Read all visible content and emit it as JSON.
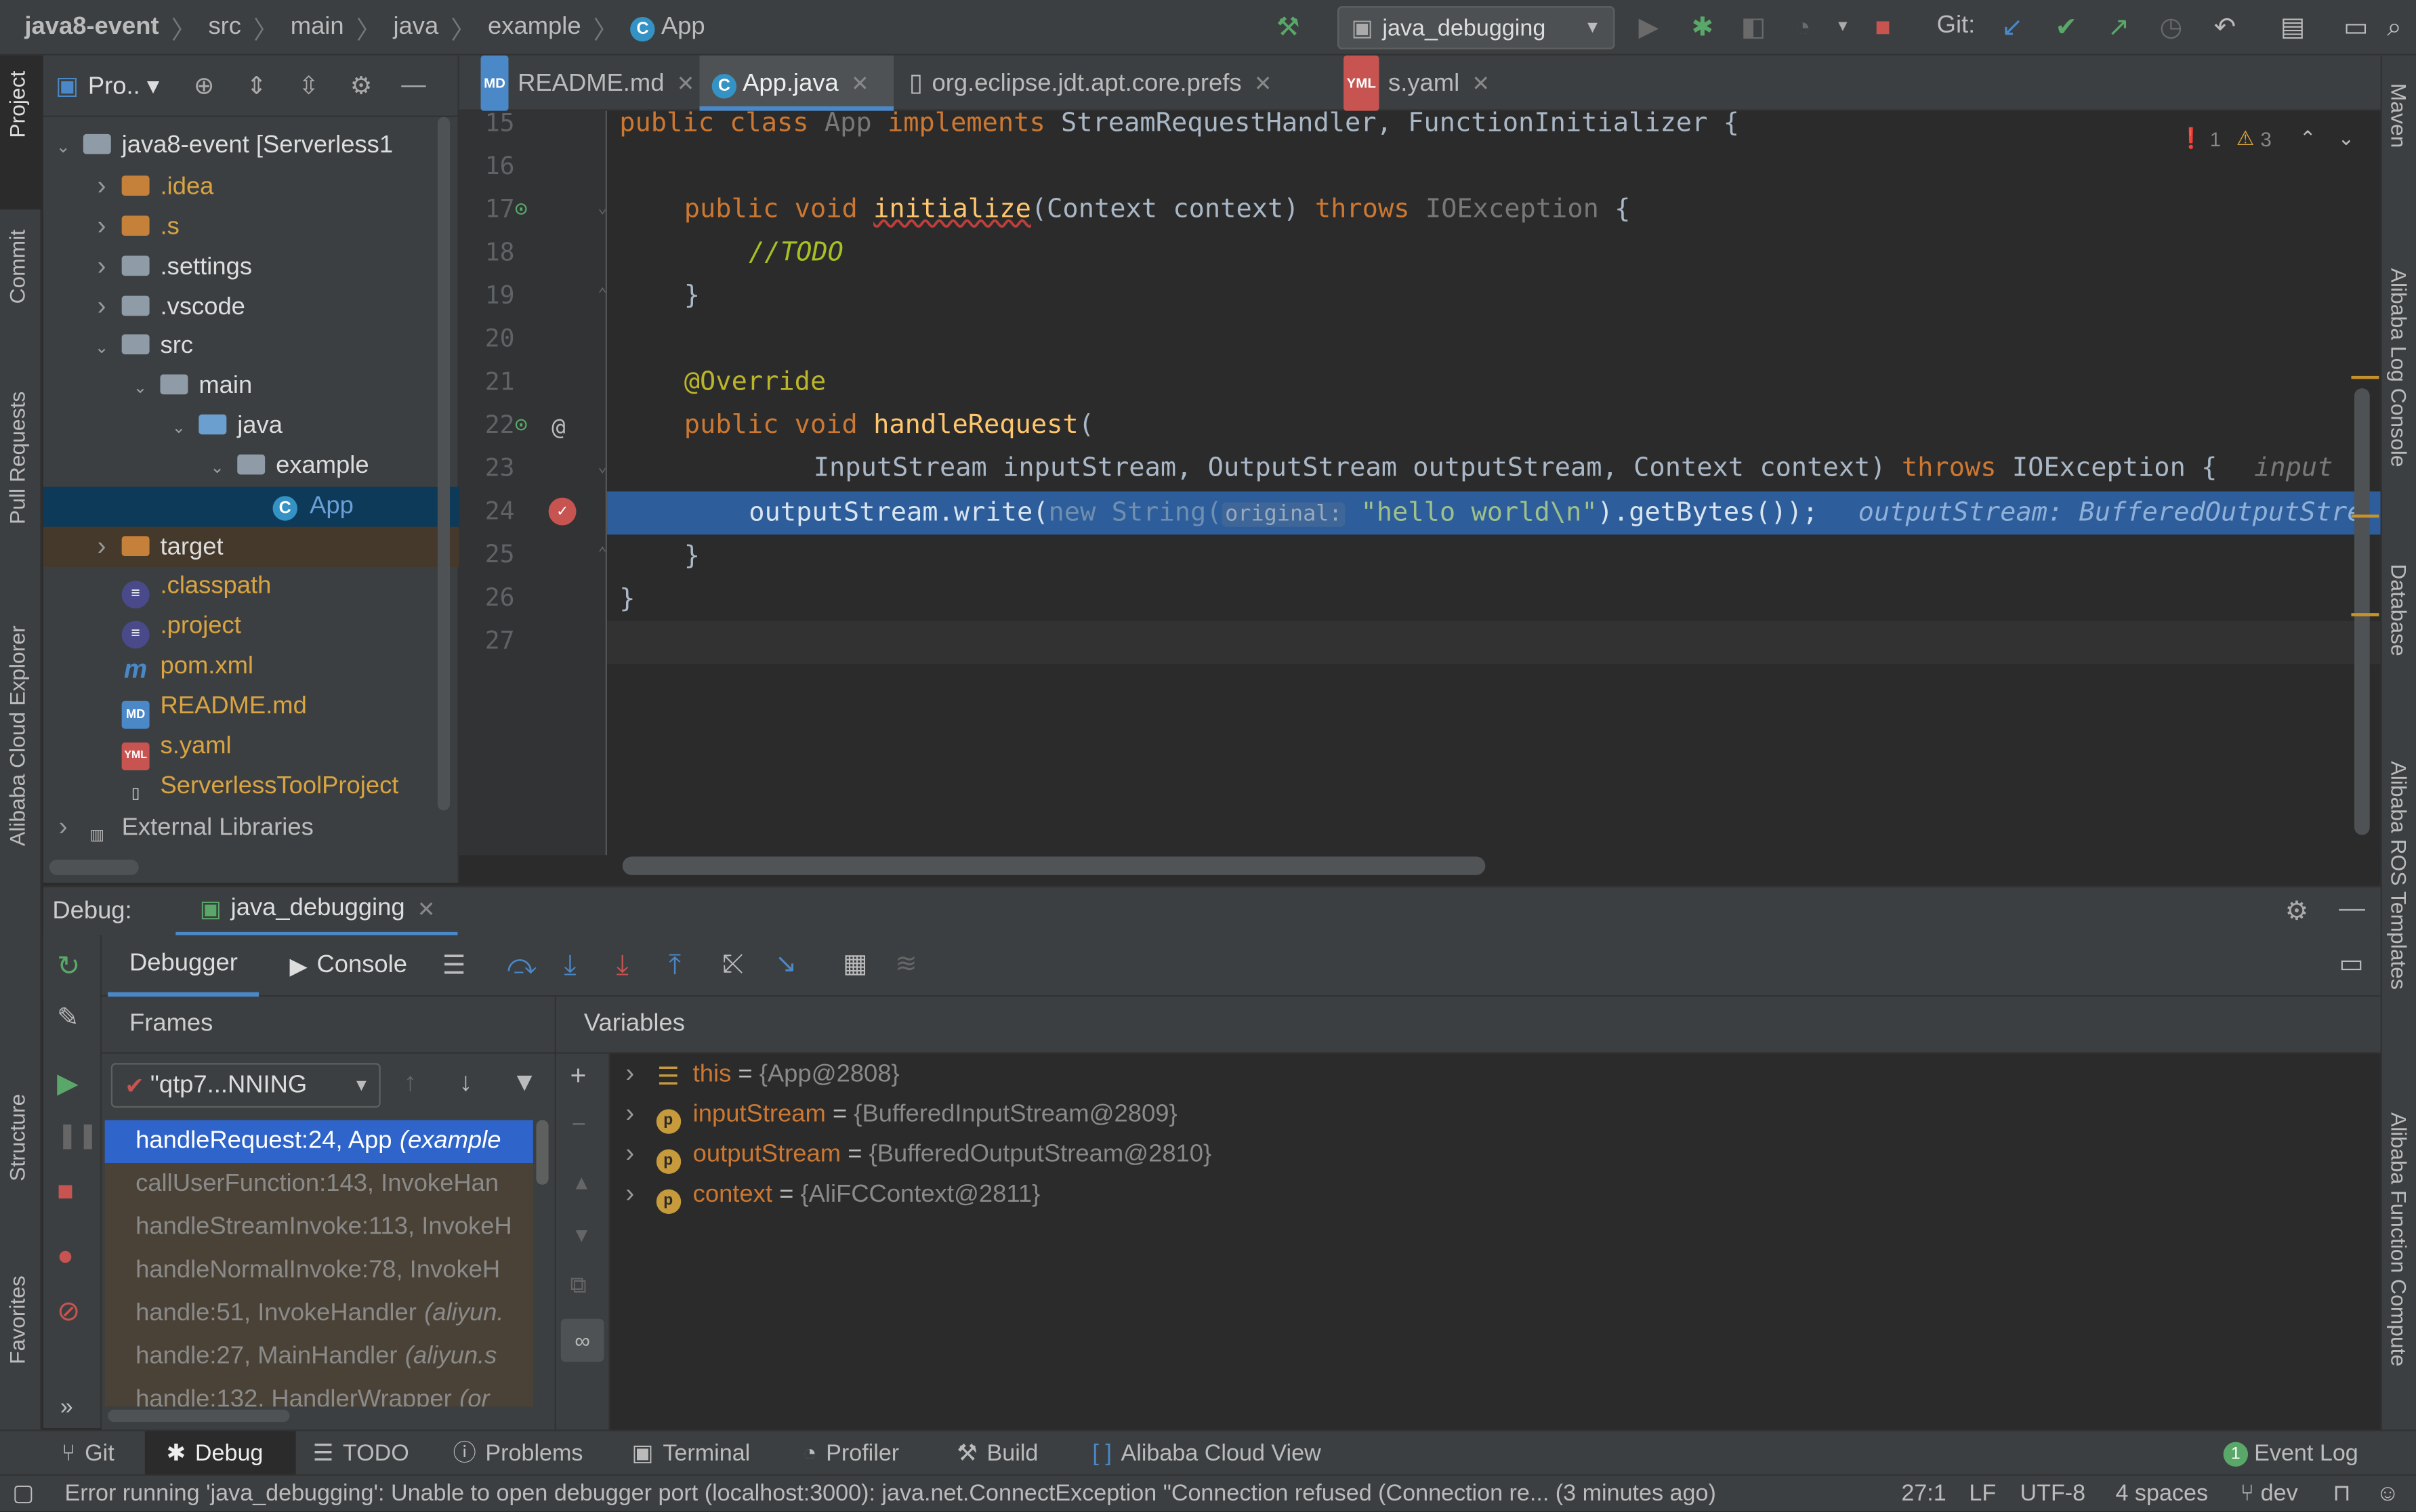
{
  "breadcrumb": [
    "java8-event",
    "src",
    "main",
    "java",
    "example",
    "App"
  ],
  "run_config": "java_debugging",
  "git_label": "Git:",
  "project_panel": {
    "title": "Pro..",
    "tree": [
      {
        "label": "java8-event [Serverless1",
        "depth": 0,
        "open": true,
        "kind": "module"
      },
      {
        "label": ".idea",
        "depth": 1,
        "open": false,
        "kind": "folder-or"
      },
      {
        "label": ".s",
        "depth": 1,
        "open": false,
        "kind": "folder-or"
      },
      {
        "label": ".settings",
        "depth": 1,
        "open": false,
        "kind": "folder"
      },
      {
        "label": ".vscode",
        "depth": 1,
        "open": false,
        "kind": "folder"
      },
      {
        "label": "src",
        "depth": 1,
        "open": true,
        "kind": "folder"
      },
      {
        "label": "main",
        "depth": 2,
        "open": true,
        "kind": "folder"
      },
      {
        "label": "java",
        "depth": 3,
        "open": true,
        "kind": "folder-bl"
      },
      {
        "label": "example",
        "depth": 4,
        "open": true,
        "kind": "package"
      },
      {
        "label": "App",
        "depth": 5,
        "kind": "class"
      },
      {
        "label": "target",
        "depth": 1,
        "open": false,
        "kind": "folder-target"
      },
      {
        "label": ".classpath",
        "depth": 1,
        "kind": "eclipse"
      },
      {
        "label": ".project",
        "depth": 1,
        "kind": "eclipse"
      },
      {
        "label": "pom.xml",
        "depth": 1,
        "kind": "maven"
      },
      {
        "label": "README.md",
        "depth": 1,
        "kind": "md"
      },
      {
        "label": "s.yaml",
        "depth": 1,
        "kind": "yaml"
      },
      {
        "label": "ServerlessToolProject",
        "depth": 1,
        "kind": "file"
      },
      {
        "label": "External Libraries",
        "depth": 0,
        "open": false,
        "kind": "libs"
      }
    ]
  },
  "tabs": [
    {
      "label": "README.md",
      "tag": "MD"
    },
    {
      "label": "App.java",
      "tag": "C"
    },
    {
      "label": "org.eclipse.jdt.apt.core.prefs",
      "tag": ""
    },
    {
      "label": "s.yaml",
      "tag": "YML"
    }
  ],
  "editor": {
    "line_numbers": [
      "15",
      "16",
      "17",
      "18",
      "19",
      "20",
      "21",
      "22",
      "23",
      "24",
      "25",
      "26",
      "27"
    ],
    "error_count": "1",
    "warning_count": "3",
    "lines": {
      "l15_kw": "public class ",
      "l15_name": "App ",
      "l15_kw2": "implements ",
      "l15_rest": "StreamRequestHandler, FunctionInitializer {",
      "l17_kw": "public void ",
      "l17_fn": "initialize",
      "l17_a": "(Context context) ",
      "l17_kw2": "throws ",
      "l17_b": "IOException",
      "l17_c": " {",
      "l18": "//TODO",
      "l19": "}",
      "l21": "@Override",
      "l22_kw": "public void ",
      "l22_fn": "handleRequest",
      "l22_a": "(",
      "l23_a": "InputStream inputStream, OutputStream outputStream, Context context) ",
      "l23_kw": "throws ",
      "l23_b": "IOException {",
      "l23_hint": "input",
      "l24_a": "outputStream.write(",
      "l24_new": "new String(",
      "l24_param": "original:",
      "l24_str": "\"hello world\\n\"",
      "l24_b": ").getBytes());",
      "l24_hint": "outputStream: BufferedOutputStre",
      "l25": "}",
      "l26": "}"
    }
  },
  "debug": {
    "label": "Debug:",
    "session": "java_debugging",
    "tab_debugger": "Debugger",
    "tab_console": "Console",
    "frames_title": "Frames",
    "variables_title": "Variables",
    "thread": "\"qtp7...NNING",
    "frames": [
      {
        "method": "handleRequest:24, App",
        "pkg": "(example"
      },
      {
        "method": "callUserFunction:143, InvokeHan",
        "pkg": ""
      },
      {
        "method": "handleStreamInvoke:113, InvokeH",
        "pkg": ""
      },
      {
        "method": "handleNormalInvoke:78, InvokeH",
        "pkg": ""
      },
      {
        "method": "handle:51, InvokeHandler",
        "pkg": "(aliyun."
      },
      {
        "method": "handle:27, MainHandler",
        "pkg": "(aliyun.s"
      },
      {
        "method": "handle:132, HandlerWrapper",
        "pkg": "(or"
      }
    ],
    "variables": [
      {
        "name": "this",
        "value": "{App@2808}",
        "icon": "="
      },
      {
        "name": "inputStream",
        "value": "{BufferedInputStream@2809}",
        "icon": "p"
      },
      {
        "name": "outputStream",
        "value": "{BufferedOutputStream@2810}",
        "icon": "p"
      },
      {
        "name": "context",
        "value": "{AliFCContext@2811}",
        "icon": "p"
      }
    ]
  },
  "left_stripe": [
    "Project",
    "Commit",
    "Pull Requests",
    "Alibaba Cloud Explorer",
    "Structure",
    "Favorites"
  ],
  "right_stripe": [
    "Maven",
    "Alibaba Log Console",
    "Database",
    "Alibaba ROS Templates",
    "Alibaba Function Compute"
  ],
  "tool_windows": [
    "Git",
    "Debug",
    "TODO",
    "Problems",
    "Terminal",
    "Profiler",
    "Build",
    "Alibaba Cloud View"
  ],
  "event_log": "Event Log",
  "event_count": "1",
  "status": {
    "message": "Error running 'java_debugging': Unable to open debugger port (localhost:3000): java.net.ConnectException \"Connection refused (Connection re... (3 minutes ago)",
    "position": "27:1",
    "line_sep": "LF",
    "encoding": "UTF-8",
    "indent": "4 spaces",
    "branch": "dev"
  },
  "colors": {
    "accent": "#4a88c7",
    "exec_line": "#2d5d9a",
    "selection": "#2f65ca",
    "keyword": "#cc7832",
    "function": "#ffc66d",
    "string": "#6a8759",
    "annotation": "#bbb529"
  }
}
